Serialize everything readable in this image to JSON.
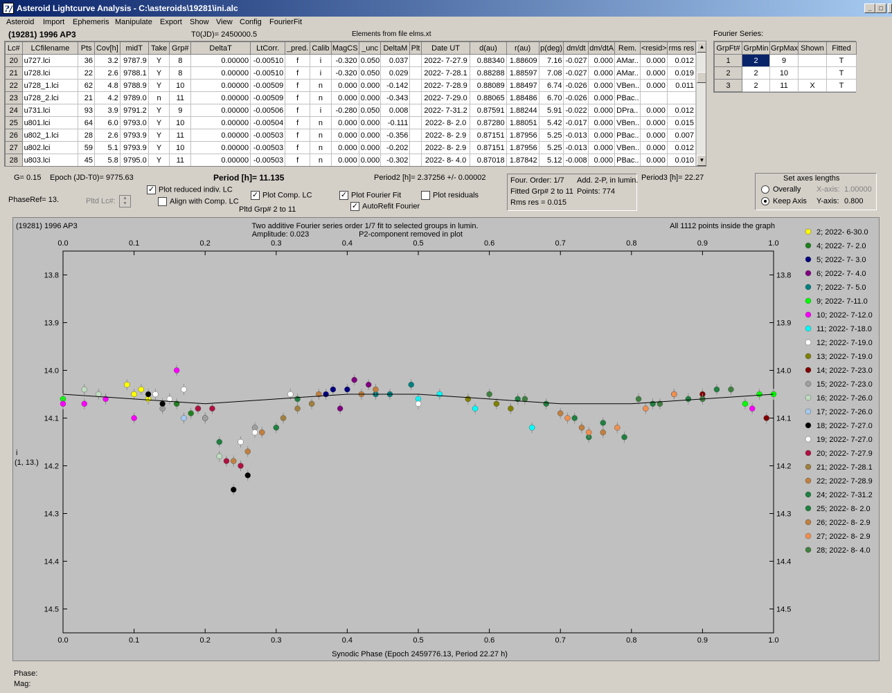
{
  "window": {
    "title": "Asteroid Lightcurve Analysis - C:\\asteroids\\19281\\ini.alc",
    "icon": "app-logo-icon",
    "min": "_",
    "max": "□",
    "close": "X"
  },
  "menu": [
    "Asteroid",
    "Import",
    "Ephemeris",
    "Manipulate",
    "Export",
    "Show",
    "View",
    "Config",
    "FourierFit"
  ],
  "header": {
    "object": "(19281) 1996 AP3",
    "t0": "T0(JD)= 2450000.5",
    "elements": "Elements from file elms.xt"
  },
  "lc_table": {
    "columns": [
      "Lc#",
      "LCfilename",
      "Pts",
      "Cov[h]",
      "midT",
      "Take",
      "Grp#",
      "DeltaT",
      "LtCorr.",
      "_pred.",
      "Calib",
      "MagCS",
      "_unc",
      "DeltaM",
      "Plt",
      "Date UT",
      "d(au)",
      "r(au)",
      "p(deg)",
      "dm/dt",
      "dm/dtA",
      "Rem.",
      "<resid>",
      "rms res"
    ],
    "rows": [
      [
        "20",
        "u727.lci",
        "36",
        "3.2",
        "9787.9",
        "Y",
        "8",
        "0.00000",
        "-0.00510",
        "f",
        "i",
        "-0.320",
        "0.050",
        "0.037",
        "",
        "2022- 7-27.9",
        "0.88340",
        "1.88609",
        "7.16",
        "-0.027",
        "0.000",
        "AMar..",
        "0.000",
        "0.012"
      ],
      [
        "21",
        "u728.lci",
        "22",
        "2.6",
        "9788.1",
        "Y",
        "8",
        "0.00000",
        "-0.00510",
        "f",
        "i",
        "-0.320",
        "0.050",
        "0.029",
        "",
        "2022- 7-28.1",
        "0.88288",
        "1.88597",
        "7.08",
        "-0.027",
        "0.000",
        "AMar..",
        "0.000",
        "0.019"
      ],
      [
        "22",
        "u728_1.lci",
        "62",
        "4.8",
        "9788.9",
        "Y",
        "10",
        "0.00000",
        "-0.00509",
        "f",
        "n",
        "0.000",
        "0.000",
        "-0.142",
        "",
        "2022- 7-28.9",
        "0.88089",
        "1.88497",
        "6.74",
        "-0.026",
        "0.000",
        "VBen..",
        "0.000",
        "0.011"
      ],
      [
        "23",
        "u728_2.lci",
        "21",
        "4.2",
        "9789.0",
        "n",
        "11",
        "0.00000",
        "-0.00509",
        "f",
        "n",
        "0.000",
        "0.000",
        "-0.343",
        "",
        "2022- 7-29.0",
        "0.88065",
        "1.88486",
        "6.70",
        "-0.026",
        "0.000",
        "PBac..",
        "",
        ""
      ],
      [
        "24",
        "u731.lci",
        "93",
        "3.9",
        "9791.2",
        "Y",
        "9",
        "0.00000",
        "-0.00506",
        "f",
        "i",
        "-0.280",
        "0.050",
        "0.008",
        "",
        "2022- 7-31.2",
        "0.87591",
        "1.88244",
        "5.91",
        "-0.022",
        "0.000",
        "DPra..",
        "0.000",
        "0.012"
      ],
      [
        "25",
        "u801.lci",
        "64",
        "6.0",
        "9793.0",
        "Y",
        "10",
        "0.00000",
        "-0.00504",
        "f",
        "n",
        "0.000",
        "0.000",
        "-0.111",
        "",
        "2022- 8- 2.0",
        "0.87280",
        "1.88051",
        "5.42",
        "-0.017",
        "0.000",
        "VBen..",
        "0.000",
        "0.015"
      ],
      [
        "26",
        "u802_1.lci",
        "28",
        "2.6",
        "9793.9",
        "Y",
        "11",
        "0.00000",
        "-0.00503",
        "f",
        "n",
        "0.000",
        "0.000",
        "-0.356",
        "",
        "2022- 8- 2.9",
        "0.87151",
        "1.87956",
        "5.25",
        "-0.013",
        "0.000",
        "PBac..",
        "0.000",
        "0.007"
      ],
      [
        "27",
        "u802.lci",
        "59",
        "5.1",
        "9793.9",
        "Y",
        "10",
        "0.00000",
        "-0.00503",
        "f",
        "n",
        "0.000",
        "0.000",
        "-0.202",
        "",
        "2022- 8- 2.9",
        "0.87151",
        "1.87956",
        "5.25",
        "-0.013",
        "0.000",
        "VBen..",
        "0.000",
        "0.012"
      ],
      [
        "28",
        "u803.lci",
        "45",
        "5.8",
        "9795.0",
        "Y",
        "11",
        "0.00000",
        "-0.00503",
        "f",
        "n",
        "0.000",
        "0.000",
        "-0.302",
        "",
        "2022- 8- 4.0",
        "0.87018",
        "1.87842",
        "5.12",
        "-0.008",
        "0.000",
        "PBac..",
        "0.000",
        "0.010"
      ]
    ]
  },
  "fourier": {
    "title": "Fourier Series:",
    "columns": [
      "GrpFt#",
      "GrpMin",
      "GrpMax",
      "Shown",
      "Fitted"
    ],
    "rows": [
      [
        "1",
        "2",
        "9",
        "",
        "T"
      ],
      [
        "2",
        "2",
        "10",
        "",
        "T"
      ],
      [
        "3",
        "2",
        "11",
        "X",
        "T"
      ]
    ]
  },
  "params": {
    "g": "G= 0.15",
    "epoch": "Epoch (JD-T0)= 9775.63",
    "period": "Period [h]= 11.135",
    "period2": "Period2 [h]= 2.37256 +/- 0.00002",
    "period3": "Period3 [h]= 22.27",
    "phaseref": "PhaseRef= 13.",
    "pltd_lc": "Pltd Lc#:",
    "pltd_grp": "Pltd Grp#  2   to   11",
    "info_order": "Four. Order:  1/7",
    "info_add": "Add. 2-P, in lumin.",
    "info_fitted": "Fitted Grp# 2 to 11",
    "info_points": "Points: 774",
    "info_rms": "Rms res      = 0.015"
  },
  "checkboxes": {
    "reduced": {
      "label": "Plot reduced indiv. LC",
      "checked": true
    },
    "align": {
      "label": "Align with Comp. LC",
      "checked": false
    },
    "comp": {
      "label": "Plot Comp. LC",
      "checked": true
    },
    "fourier": {
      "label": "Plot Fourier Fit",
      "checked": true
    },
    "autorefit": {
      "label": "AutoRefit Fourier",
      "checked": true
    },
    "residuals": {
      "label": "Plot residuals",
      "checked": false
    },
    "check_mark": "✓"
  },
  "axes_box": {
    "title": "Set axes lengths",
    "overall": "Overally",
    "keep": "Keep Axis",
    "xaxis": "X-axis:",
    "xval": "1.00000",
    "yaxis": "Y-axis:",
    "yval": "0.800"
  },
  "chart_data": {
    "type": "scatter",
    "title_left": "(19281) 1996 AP3",
    "title_center": "Two additive Fourier series order 1/7 fit to selected groups in lumin.",
    "amplitude": "Amplitude: 0.023",
    "p2note": "P2-component removed in plot",
    "title_right": "All 1112 points inside the graph",
    "xlabel": "Synodic Phase (Epoch 2459776.13, Period 22.27 h)",
    "ylabel": "i",
    "ylabel2": "(1, 13.)",
    "xlim": [
      0.0,
      1.0
    ],
    "ylim": [
      13.75,
      14.55
    ],
    "y_inverted": true,
    "xticks": [
      "0.0",
      "0.1",
      "0.2",
      "0.3",
      "0.4",
      "0.5",
      "0.6",
      "0.7",
      "0.8",
      "0.9",
      "1.0"
    ],
    "yticks": [
      "13.8",
      "13.9",
      "14.0",
      "14.1",
      "14.2",
      "14.3",
      "14.4",
      "14.5"
    ],
    "grid": false,
    "legend_position": "right",
    "legend": [
      {
        "label": "2; 2022- 6-30.0",
        "color": "#ffff00",
        "x": [
          0.09,
          0.1,
          0.11,
          0.12
        ],
        "y": [
          14.03,
          14.05,
          14.04,
          14.06
        ]
      },
      {
        "label": "4; 2022- 7- 2.0",
        "color": "#208020",
        "x": [
          0.16,
          0.18,
          0.2
        ],
        "y": [
          14.07,
          14.09,
          14.1
        ]
      },
      {
        "label": "5; 2022- 7- 3.0",
        "color": "#000080",
        "x": [
          0.37,
          0.38,
          0.4
        ],
        "y": [
          14.05,
          14.04,
          14.04
        ]
      },
      {
        "label": "6; 2022- 7- 4.0",
        "color": "#800080",
        "x": [
          0.39,
          0.41,
          0.43
        ],
        "y": [
          14.08,
          14.02,
          14.03
        ]
      },
      {
        "label": "7; 2022- 7- 5.0",
        "color": "#008080",
        "x": [
          0.44,
          0.46,
          0.49
        ],
        "y": [
          14.05,
          14.05,
          14.03
        ]
      },
      {
        "label": "9; 2022- 7-11.0",
        "color": "#00ff00",
        "x": [
          0.0,
          0.96,
          0.98,
          1.0
        ],
        "y": [
          14.06,
          14.07,
          14.05,
          14.05
        ]
      },
      {
        "label": "10; 2022- 7-12.0",
        "color": "#ff00ff",
        "x": [
          0.0,
          0.03,
          0.06,
          0.1,
          0.16,
          0.97
        ],
        "y": [
          14.07,
          14.07,
          14.06,
          14.1,
          14.0,
          14.08
        ]
      },
      {
        "label": "11; 2022- 7-18.0",
        "color": "#00ffff",
        "x": [
          0.5,
          0.53,
          0.58,
          0.66
        ],
        "y": [
          14.06,
          14.05,
          14.08,
          14.12
        ]
      },
      {
        "label": "12; 2022- 7-19.0",
        "color": "#ffffff",
        "x": [
          0.13,
          0.15,
          0.17,
          0.5
        ],
        "y": [
          14.05,
          14.06,
          14.04,
          14.07
        ]
      },
      {
        "label": "13; 2022- 7-19.0",
        "color": "#808000",
        "x": [
          0.57,
          0.61,
          0.63
        ],
        "y": [
          14.06,
          14.07,
          14.08
        ]
      },
      {
        "label": "14; 2022- 7-23.0",
        "color": "#800000",
        "x": [
          0.86,
          0.9,
          0.99
        ],
        "y": [
          14.05,
          14.05,
          14.1
        ]
      },
      {
        "label": "15; 2022- 7-23.0",
        "color": "#a0a0a0",
        "x": [
          0.14,
          0.2,
          0.27
        ],
        "y": [
          14.08,
          14.1,
          14.12
        ]
      },
      {
        "label": "16; 2022- 7-26.0",
        "color": "#c0dcc0",
        "x": [
          0.03,
          0.05,
          0.22
        ],
        "y": [
          14.04,
          14.05,
          14.18
        ]
      },
      {
        "label": "17; 2022- 7-26.0",
        "color": "#a6caf0",
        "x": [
          0.17,
          0.19
        ],
        "y": [
          14.1,
          14.08
        ]
      },
      {
        "label": "18; 2022- 7-27.0",
        "color": "#000000",
        "x": [
          0.12,
          0.14,
          0.24,
          0.26
        ],
        "y": [
          14.05,
          14.07,
          14.25,
          14.22
        ]
      },
      {
        "label": "19; 2022- 7-27.0",
        "color": "#ffffff",
        "x": [
          0.25,
          0.27,
          0.32
        ],
        "y": [
          14.15,
          14.13,
          14.05
        ]
      },
      {
        "label": "20; 2022- 7-27.9",
        "color": "#b01040",
        "x": [
          0.19,
          0.21,
          0.23,
          0.25
        ],
        "y": [
          14.08,
          14.08,
          14.19,
          14.2
        ]
      },
      {
        "label": "21; 2022- 7-28.1",
        "color": "#a08040",
        "x": [
          0.31,
          0.33,
          0.35
        ],
        "y": [
          14.1,
          14.08,
          14.07
        ]
      },
      {
        "label": "22; 2022- 7-28.9",
        "color": "#c08040",
        "x": [
          0.24,
          0.26,
          0.28,
          0.36,
          0.42,
          0.44
        ],
        "y": [
          14.19,
          14.17,
          14.13,
          14.05,
          14.05,
          14.04
        ]
      },
      {
        "label": "24; 2022- 7-31.2",
        "color": "#208040",
        "x": [
          0.22,
          0.3,
          0.33,
          0.76,
          0.79,
          0.83,
          0.88
        ],
        "y": [
          14.15,
          14.12,
          14.06,
          14.11,
          14.14,
          14.07,
          14.06
        ]
      },
      {
        "label": "25; 2022- 8- 2.0",
        "color": "#208040",
        "x": [
          0.64,
          0.68,
          0.72,
          0.74,
          0.92
        ],
        "y": [
          14.06,
          14.07,
          14.1,
          14.14,
          14.04
        ]
      },
      {
        "label": "26; 2022- 8- 2.9",
        "color": "#c08040",
        "x": [
          0.7,
          0.73,
          0.76
        ],
        "y": [
          14.09,
          14.12,
          14.13
        ]
      },
      {
        "label": "27; 2022- 8- 2.9",
        "color": "#f09050",
        "x": [
          0.71,
          0.74,
          0.78,
          0.82,
          0.86
        ],
        "y": [
          14.1,
          14.13,
          14.12,
          14.08,
          14.05
        ]
      },
      {
        "label": "28; 2022- 8- 4.0",
        "color": "#408040",
        "x": [
          0.6,
          0.65,
          0.81,
          0.84,
          0.9,
          0.94
        ],
        "y": [
          14.05,
          14.06,
          14.06,
          14.07,
          14.06,
          14.04
        ]
      }
    ],
    "fit_line": {
      "x": [
        0.0,
        0.1,
        0.2,
        0.3,
        0.4,
        0.5,
        0.6,
        0.7,
        0.8,
        0.9,
        1.0
      ],
      "y": [
        14.05,
        14.06,
        14.07,
        14.06,
        14.05,
        14.05,
        14.06,
        14.07,
        14.07,
        14.06,
        14.05
      ]
    }
  },
  "status": {
    "phase": "Phase:",
    "mag": "Mag:"
  }
}
